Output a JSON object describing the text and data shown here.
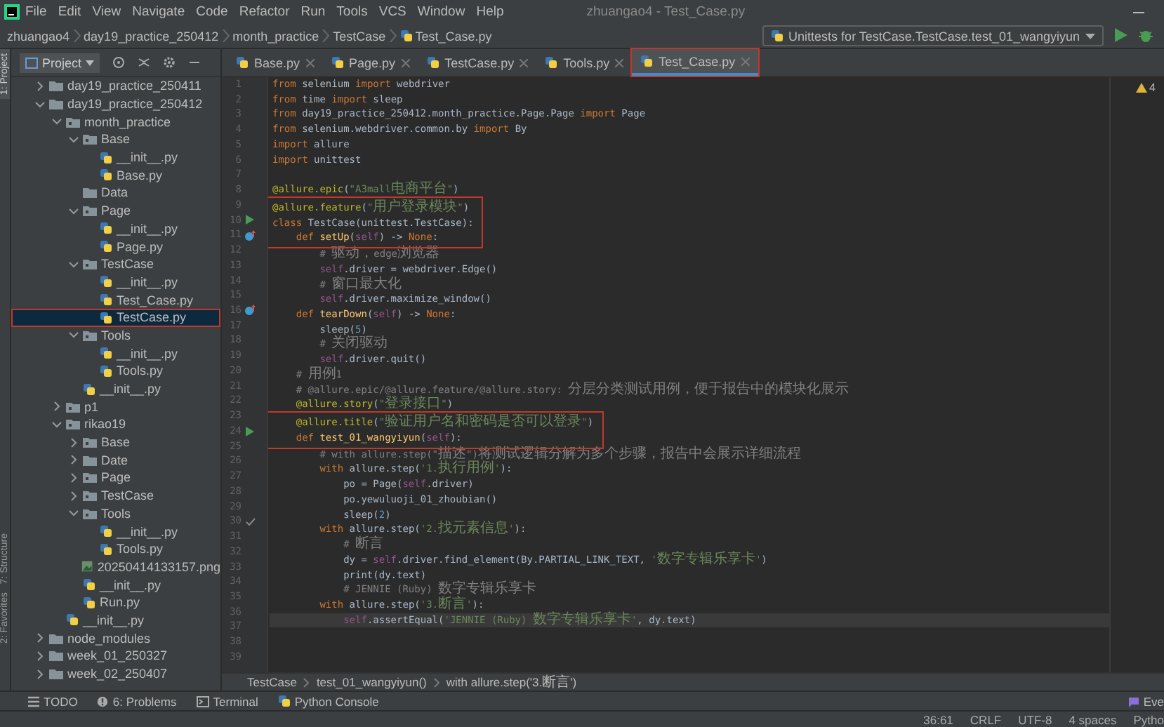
{
  "window": {
    "title": "zhuangao4 - Test_Case.py"
  },
  "menu": [
    "File",
    "Edit",
    "View",
    "Navigate",
    "Code",
    "Refactor",
    "Run",
    "Tools",
    "VCS",
    "Window",
    "Help"
  ],
  "navigation": {
    "breadcrumbs": [
      {
        "label": "zhuangao4",
        "kind": "folder"
      },
      {
        "label": "day19_practice_250412",
        "kind": "folder"
      },
      {
        "label": "month_practice",
        "kind": "folder"
      },
      {
        "label": "TestCase",
        "kind": "folder"
      },
      {
        "label": "Test_Case.py",
        "kind": "file"
      }
    ],
    "run_configuration": "Unittests for TestCase.TestCase.test_01_wangyiyun"
  },
  "side_stripe": [
    {
      "label": "1: Project",
      "selected": true
    },
    {
      "label": "7: Structure",
      "selected": false
    },
    {
      "label": "2: Favorites",
      "selected": false
    }
  ],
  "project": {
    "title": "Project",
    "tree": [
      {
        "label": "day19_practice_250411",
        "kind": "folder",
        "expanded": false,
        "selected": false,
        "marked": false
      },
      {
        "label": "day19_practice_250412",
        "kind": "folder",
        "expanded": true,
        "selected": false,
        "marked": false,
        "children": [
          {
            "label": "month_practice",
            "kind": "package",
            "expanded": true,
            "selected": false,
            "marked": false,
            "children": [
              {
                "label": "Base",
                "kind": "package",
                "expanded": true,
                "selected": false,
                "marked": false,
                "children": [
                  {
                    "label": "__init__.py",
                    "kind": "python",
                    "selected": false,
                    "marked": false
                  },
                  {
                    "label": "Base.py",
                    "kind": "python",
                    "selected": false,
                    "marked": false
                  }
                ]
              },
              {
                "label": "Data",
                "kind": "folder",
                "selected": false,
                "marked": false
              },
              {
                "label": "Page",
                "kind": "package",
                "expanded": true,
                "selected": false,
                "marked": false,
                "children": [
                  {
                    "label": "__init__.py",
                    "kind": "python",
                    "selected": false,
                    "marked": false
                  },
                  {
                    "label": "Page.py",
                    "kind": "python",
                    "selected": false,
                    "marked": false
                  }
                ]
              },
              {
                "label": "TestCase",
                "kind": "package",
                "expanded": true,
                "selected": false,
                "marked": false,
                "children": [
                  {
                    "label": "__init__.py",
                    "kind": "python",
                    "selected": false,
                    "marked": false
                  },
                  {
                    "label": "Test_Case.py",
                    "kind": "python",
                    "selected": false,
                    "marked": false
                  },
                  {
                    "label": "TestCase.py",
                    "kind": "python",
                    "selected": true,
                    "marked": true
                  }
                ]
              },
              {
                "label": "Tools",
                "kind": "package",
                "expanded": true,
                "selected": false,
                "marked": false,
                "children": [
                  {
                    "label": "__init__.py",
                    "kind": "python",
                    "selected": false,
                    "marked": false
                  },
                  {
                    "label": "Tools.py",
                    "kind": "python",
                    "selected": false,
                    "marked": false
                  }
                ]
              },
              {
                "label": "__init__.py",
                "kind": "python",
                "selected": false,
                "marked": false
              }
            ]
          },
          {
            "label": "p1",
            "kind": "package",
            "expanded": false,
            "selected": false,
            "marked": false
          },
          {
            "label": "rikao19",
            "kind": "package",
            "expanded": true,
            "selected": false,
            "marked": false,
            "children": [
              {
                "label": "Base",
                "kind": "package",
                "expanded": false,
                "selected": false,
                "marked": false
              },
              {
                "label": "Date",
                "kind": "folder",
                "expanded": false,
                "selected": false,
                "marked": false
              },
              {
                "label": "Page",
                "kind": "package",
                "expanded": false,
                "selected": false,
                "marked": false
              },
              {
                "label": "TestCase",
                "kind": "package",
                "expanded": false,
                "selected": false,
                "marked": false
              },
              {
                "label": "Tools",
                "kind": "package",
                "expanded": true,
                "selected": false,
                "marked": false,
                "children": [
                  {
                    "label": "__init__.py",
                    "kind": "python",
                    "selected": false,
                    "marked": false
                  },
                  {
                    "label": "Tools.py",
                    "kind": "python",
                    "selected": false,
                    "marked": false
                  }
                ]
              },
              {
                "label": "20250414133157.png",
                "kind": "image",
                "selected": false,
                "marked": false
              },
              {
                "label": "__init__.py",
                "kind": "python",
                "selected": false,
                "marked": false
              },
              {
                "label": "Run.py",
                "kind": "python",
                "selected": false,
                "marked": false
              }
            ]
          },
          {
            "label": "__init__.py",
            "kind": "python",
            "selected": false,
            "marked": false
          }
        ]
      },
      {
        "label": "node_modules",
        "kind": "folder",
        "expanded": false,
        "selected": false,
        "marked": false
      },
      {
        "label": "week_01_250327",
        "kind": "folder",
        "expanded": false,
        "selected": false,
        "marked": false
      },
      {
        "label": "week_02_250407",
        "kind": "folder",
        "expanded": false,
        "selected": false,
        "marked": false
      }
    ]
  },
  "editor": {
    "tabs": [
      {
        "label": "Base.py",
        "selected": false,
        "marked": false
      },
      {
        "label": "Page.py",
        "selected": false,
        "marked": false
      },
      {
        "label": "TestCase.py",
        "selected": false,
        "marked": false
      },
      {
        "label": "Tools.py",
        "selected": false,
        "marked": false
      },
      {
        "label": "Test_Case.py",
        "selected": true,
        "marked": true
      }
    ],
    "warnings": "4",
    "lines": [
      {
        "number": "1",
        "marked": false,
        "current": false,
        "tokens": [
          {
            "kind": "kw",
            "text": "from "
          },
          {
            "kind": "pl",
            "text": "selenium "
          },
          {
            "kind": "kw",
            "text": "import "
          },
          {
            "kind": "pl",
            "text": "webdriver"
          }
        ]
      },
      {
        "number": "2",
        "marked": false,
        "current": false,
        "tokens": [
          {
            "kind": "kw",
            "text": "from "
          },
          {
            "kind": "pl",
            "text": "time "
          },
          {
            "kind": "kw",
            "text": "import "
          },
          {
            "kind": "pl",
            "text": "sleep"
          }
        ]
      },
      {
        "number": "3",
        "marked": false,
        "current": false,
        "tokens": [
          {
            "kind": "kw",
            "text": "from "
          },
          {
            "kind": "pl",
            "text": "day19_practice_250412.month_practice.Page.Page "
          },
          {
            "kind": "kw",
            "text": "import "
          },
          {
            "kind": "pl",
            "text": "Page"
          }
        ]
      },
      {
        "number": "4",
        "marked": false,
        "current": false,
        "tokens": [
          {
            "kind": "kw",
            "text": "from "
          },
          {
            "kind": "pl",
            "text": "selenium.webdriver.common.by "
          },
          {
            "kind": "kw",
            "text": "import "
          },
          {
            "kind": "pl",
            "text": "By"
          }
        ]
      },
      {
        "number": "5",
        "marked": false,
        "current": false,
        "tokens": [
          {
            "kind": "kw",
            "text": "import "
          },
          {
            "kind": "pl",
            "text": "allure"
          }
        ]
      },
      {
        "number": "6",
        "marked": false,
        "current": false,
        "tokens": [
          {
            "kind": "kw",
            "text": "import "
          },
          {
            "kind": "pl",
            "text": "unittest"
          }
        ]
      },
      {
        "number": "7",
        "marked": false,
        "current": false
      },
      {
        "number": "8",
        "marked": false,
        "current": false,
        "tokens": [
          {
            "kind": "dec",
            "text": "@allure.epic"
          },
          {
            "kind": "pl",
            "text": "("
          },
          {
            "kind": "str",
            "text": "\"A3mall电商平台\""
          },
          {
            "kind": "pl",
            "text": ")"
          }
        ]
      },
      {
        "number": "9",
        "marked": true,
        "current": false,
        "tokens": [
          {
            "kind": "dec",
            "text": "@allure.feature"
          },
          {
            "kind": "pl",
            "text": "("
          },
          {
            "kind": "str",
            "text": "\"用户登录模块\""
          },
          {
            "kind": "pl",
            "text": ")"
          }
        ]
      },
      {
        "number": "10",
        "kind": "run",
        "marked": true,
        "current": false,
        "tokens": [
          {
            "kind": "kw",
            "text": "class "
          },
          {
            "kind": "pl",
            "text": "TestCase(unittest.TestCase):"
          }
        ]
      },
      {
        "number": "11",
        "kind": "override",
        "marked": true,
        "current": false,
        "tokens": [
          {
            "kind": "kw",
            "text": "    def "
          },
          {
            "kind": "fn",
            "text": "setUp"
          },
          {
            "kind": "pl",
            "text": "("
          },
          {
            "kind": "self",
            "text": "self"
          },
          {
            "kind": "pl",
            "text": ") -> "
          },
          {
            "kind": "kw",
            "text": "None"
          },
          {
            "kind": "pl",
            "text": ":"
          }
        ]
      },
      {
        "number": "12",
        "marked": false,
        "current": false,
        "tokens": [
          {
            "kind": "cmt",
            "text": "        # 驱动，edge浏览器"
          }
        ]
      },
      {
        "number": "13",
        "marked": false,
        "current": false,
        "tokens": [
          {
            "kind": "self",
            "text": "        self"
          },
          {
            "kind": "pl",
            "text": ".driver = webdriver.Edge()"
          }
        ]
      },
      {
        "number": "14",
        "marked": false,
        "current": false,
        "tokens": [
          {
            "kind": "cmt",
            "text": "        # 窗口最大化"
          }
        ]
      },
      {
        "number": "15",
        "marked": false,
        "current": false,
        "tokens": [
          {
            "kind": "self",
            "text": "        self"
          },
          {
            "kind": "pl",
            "text": ".driver.maximize_window()"
          }
        ]
      },
      {
        "number": "16",
        "kind": "override",
        "marked": false,
        "current": false,
        "tokens": [
          {
            "kind": "kw",
            "text": "    def "
          },
          {
            "kind": "fn",
            "text": "tearDown"
          },
          {
            "kind": "pl",
            "text": "("
          },
          {
            "kind": "self",
            "text": "self"
          },
          {
            "kind": "pl",
            "text": ") -> "
          },
          {
            "kind": "kw",
            "text": "None"
          },
          {
            "kind": "pl",
            "text": ":"
          }
        ]
      },
      {
        "number": "17",
        "marked": false,
        "current": false,
        "tokens": [
          {
            "kind": "pl",
            "text": "        sleep("
          },
          {
            "kind": "num",
            "text": "5"
          },
          {
            "kind": "pl",
            "text": ")"
          }
        ]
      },
      {
        "number": "18",
        "marked": false,
        "current": false,
        "tokens": [
          {
            "kind": "cmt",
            "text": "        # 关闭驱动"
          }
        ]
      },
      {
        "number": "19",
        "marked": false,
        "current": false,
        "tokens": [
          {
            "kind": "self",
            "text": "        self"
          },
          {
            "kind": "pl",
            "text": ".driver.quit()"
          }
        ]
      },
      {
        "number": "20",
        "marked": false,
        "current": false,
        "tokens": [
          {
            "kind": "cmt",
            "text": "    # 用例1"
          }
        ]
      },
      {
        "number": "21",
        "marked": false,
        "current": false,
        "tokens": [
          {
            "kind": "cmt",
            "text": "    # @allure.epic/@allure.feature/@allure.story: 分层分类测试用例，便于报告中的模块化展示"
          }
        ]
      },
      {
        "number": "22",
        "marked": false,
        "current": false,
        "tokens": [
          {
            "kind": "dec",
            "text": "    @allure.story"
          },
          {
            "kind": "pl",
            "text": "("
          },
          {
            "kind": "str",
            "text": "\"登录接口\""
          },
          {
            "kind": "pl",
            "text": ")"
          }
        ]
      },
      {
        "number": "23",
        "marked": true,
        "current": false,
        "tokens": [
          {
            "kind": "dec",
            "text": "    @allure.title"
          },
          {
            "kind": "pl",
            "text": "("
          },
          {
            "kind": "str",
            "text": "\"验证用户名和密码是否可以登录\""
          },
          {
            "kind": "pl",
            "text": ")"
          }
        ]
      },
      {
        "number": "24",
        "kind": "run",
        "marked": true,
        "current": false,
        "tokens": [
          {
            "kind": "kw",
            "text": "    def "
          },
          {
            "kind": "fn",
            "text": "test_01_wangyiyun"
          },
          {
            "kind": "pl",
            "text": "("
          },
          {
            "kind": "self",
            "text": "self"
          },
          {
            "kind": "pl",
            "text": "):"
          }
        ]
      },
      {
        "number": "25",
        "marked": false,
        "current": false,
        "tokens": [
          {
            "kind": "cmt",
            "text": "        # with allure.step(\"描述\")将测试逻辑分解为多个步骤，报告中会展示详细流程"
          }
        ]
      },
      {
        "number": "26",
        "marked": false,
        "current": false,
        "tokens": [
          {
            "kind": "kw",
            "text": "        with "
          },
          {
            "kind": "pl",
            "text": "allure.step("
          },
          {
            "kind": "str",
            "text": "'1.执行用例'"
          },
          {
            "kind": "pl",
            "text": "):"
          }
        ]
      },
      {
        "number": "27",
        "marked": false,
        "current": false,
        "tokens": [
          {
            "kind": "pl",
            "text": "            po = Page("
          },
          {
            "kind": "self",
            "text": "self"
          },
          {
            "kind": "pl",
            "text": ".driver)"
          }
        ]
      },
      {
        "number": "28",
        "marked": false,
        "current": false,
        "tokens": [
          {
            "kind": "pl",
            "text": "            po.yewuluoji_01_zhoubian()"
          }
        ]
      },
      {
        "number": "29",
        "marked": false,
        "current": false,
        "tokens": [
          {
            "kind": "pl",
            "text": "            sleep("
          },
          {
            "kind": "num",
            "text": "2"
          },
          {
            "kind": "pl",
            "text": ")"
          }
        ]
      },
      {
        "number": "30",
        "kind": "check",
        "marked": false,
        "current": false,
        "tokens": [
          {
            "kind": "kw",
            "text": "        with "
          },
          {
            "kind": "pl",
            "text": "allure.step("
          },
          {
            "kind": "str",
            "text": "'2.找元素信息'"
          },
          {
            "kind": "pl",
            "text": "):"
          }
        ]
      },
      {
        "number": "31",
        "marked": false,
        "current": false,
        "tokens": [
          {
            "kind": "cmt",
            "text": "            # 断言"
          }
        ]
      },
      {
        "number": "32",
        "marked": false,
        "current": false,
        "tokens": [
          {
            "kind": "pl",
            "text": "            dy = "
          },
          {
            "kind": "self",
            "text": "self"
          },
          {
            "kind": "pl",
            "text": ".driver.find_element(By.PARTIAL_LINK_TEXT, "
          },
          {
            "kind": "str",
            "text": "'数字专辑乐享卡'"
          },
          {
            "kind": "pl",
            "text": ")"
          }
        ]
      },
      {
        "number": "33",
        "marked": false,
        "current": false,
        "tokens": [
          {
            "kind": "pl",
            "text": "            print(dy.text)"
          }
        ]
      },
      {
        "number": "34",
        "marked": false,
        "current": false,
        "tokens": [
          {
            "kind": "cmt",
            "text": "            # JENNIE (Ruby) 数字专辑乐享卡"
          }
        ]
      },
      {
        "number": "35",
        "marked": false,
        "current": false,
        "tokens": [
          {
            "kind": "kw",
            "text": "        with "
          },
          {
            "kind": "pl",
            "text": "allure.step("
          },
          {
            "kind": "str",
            "text": "'3.断言'"
          },
          {
            "kind": "pl",
            "text": "):"
          }
        ]
      },
      {
        "number": "36",
        "marked": false,
        "current": true,
        "tokens": [
          {
            "kind": "self",
            "text": "            self"
          },
          {
            "kind": "pl",
            "text": ".assertEqual("
          },
          {
            "kind": "str",
            "text": "'JENNIE (Ruby) 数字专辑乐享卡'"
          },
          {
            "kind": "pl",
            "text": ", dy.text)"
          }
        ]
      },
      {
        "number": "37",
        "marked": false,
        "current": false
      },
      {
        "number": "38",
        "marked": false,
        "current": false
      },
      {
        "number": "39",
        "marked": false,
        "current": false
      }
    ],
    "breadcrumbs": [
      "TestCase",
      "test_01_wangyiyun()",
      "with allure.step('3.断言')"
    ]
  },
  "tool_windows": [
    {
      "label": "TODO",
      "kind": "list"
    },
    {
      "label": "6: Problems",
      "kind": "alert"
    },
    {
      "label": "Terminal",
      "kind": "terminal"
    },
    {
      "label": "Python Console",
      "kind": "python"
    }
  ],
  "event_log": "Eve",
  "status_bar": [
    "36:61",
    "CRLF",
    "UTF-8",
    "4 spaces",
    "Pytho"
  ]
}
